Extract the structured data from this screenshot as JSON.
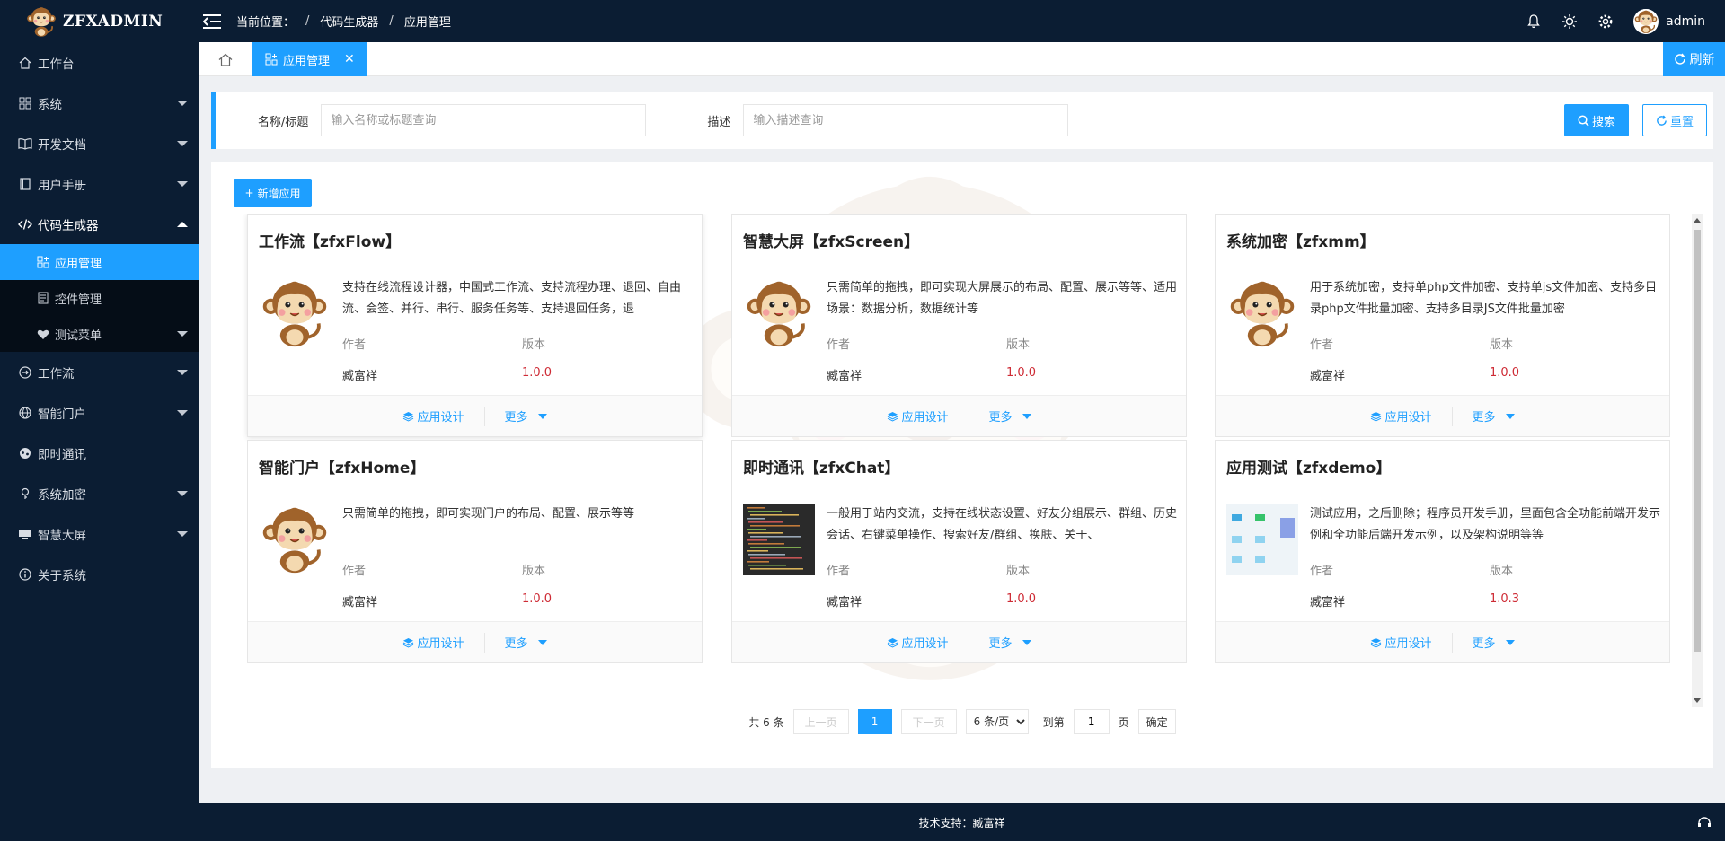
{
  "app": {
    "logo_text": "ZFXADMIN"
  },
  "header": {
    "breadcrumb_label": "当前位置：",
    "breadcrumbs": [
      "代码生成器",
      "应用管理"
    ],
    "user_name": "admin"
  },
  "sidebar": {
    "items": [
      {
        "label": "工作台",
        "icon": "home-icon"
      },
      {
        "label": "系统",
        "icon": "apps-icon"
      },
      {
        "label": "开发文档",
        "icon": "book-icon"
      },
      {
        "label": "用户手册",
        "icon": "manual-icon"
      },
      {
        "label": "代码生成器",
        "icon": "code-icon"
      },
      {
        "label": "工作流",
        "icon": "workflow-icon"
      },
      {
        "label": "智能门户",
        "icon": "globe-icon"
      },
      {
        "label": "即时通讯",
        "icon": "chat-icon"
      },
      {
        "label": "系统加密",
        "icon": "key-icon"
      },
      {
        "label": "智慧大屏",
        "icon": "screen-icon"
      },
      {
        "label": "关于系统",
        "icon": "info-icon"
      }
    ],
    "sub_items": [
      {
        "label": "应用管理",
        "icon": "apps-add-icon"
      },
      {
        "label": "控件管理",
        "icon": "widget-icon"
      },
      {
        "label": "测试菜单",
        "icon": "heart-icon"
      }
    ]
  },
  "tabs": {
    "active_label": "应用管理",
    "refresh_label": "刷新"
  },
  "search": {
    "name_label": "名称/标题",
    "name_placeholder": "输入名称或标题查询",
    "desc_label": "描述",
    "desc_placeholder": "输入描述查询",
    "search_btn": "搜索",
    "reset_btn": "重置"
  },
  "toolbar": {
    "add_label": "新增应用"
  },
  "card_common": {
    "author_label": "作者",
    "version_label": "版本",
    "design_btn": "应用设计",
    "more_btn": "更多"
  },
  "cards": [
    {
      "title": "工作流【zfxFlow】",
      "desc": "支持在线流程设计器，中国式工作流、支持流程办理、退回、自由流、会签、并行、串行、服务任务等、支持退回任务，退",
      "author": "臧富祥",
      "version": "1.0.0",
      "image": "monkey"
    },
    {
      "title": "智慧大屏【zfxScreen】",
      "desc": "只需简单的拖拽，即可实现大屏展示的布局、配置、展示等等、适用场景：数据分析，数据统计等",
      "author": "臧富祥",
      "version": "1.0.0",
      "image": "monkey"
    },
    {
      "title": "系统加密【zfxmm】",
      "desc": "用于系统加密，支持单php文件加密、支持单js文件加密、支持多目录php文件批量加密、支持多目录JS文件批量加密",
      "author": "臧富祥",
      "version": "1.0.0",
      "image": "monkey"
    },
    {
      "title": "智能门户【zfxHome】",
      "desc": "只需简单的拖拽，即可实现门户的布局、配置、展示等等",
      "author": "臧富祥",
      "version": "1.0.0",
      "image": "monkey"
    },
    {
      "title": "即时通讯【zfxChat】",
      "desc": "一般用于站内交流，支持在线状态设置、好友分组展示、群组、历史会话、右键菜单操作、搜索好友/群组、换肤、关于、",
      "author": "臧富祥",
      "version": "1.0.0",
      "image": "code-screenshot"
    },
    {
      "title": "应用测试【zfxdemo】",
      "desc": "测试应用，之后删除；程序员开发手册，里面包含全功能前端开发示例和全功能后端开发示例，以及架构说明等等",
      "author": "臧富祥",
      "version": "1.0.3",
      "image": "diagram"
    }
  ],
  "pager": {
    "total": "共 6 条",
    "prev": "上一页",
    "current": "1",
    "next": "下一页",
    "page_size": "6 条/页",
    "goto_label": "到第",
    "goto_value": "1",
    "page_unit": "页",
    "confirm": "确定"
  },
  "footer": {
    "text": "技术支持：臧富祥"
  },
  "colors": {
    "primary": "#1e9fff",
    "dark": "#0b1d33",
    "version": "#ce2b35"
  }
}
